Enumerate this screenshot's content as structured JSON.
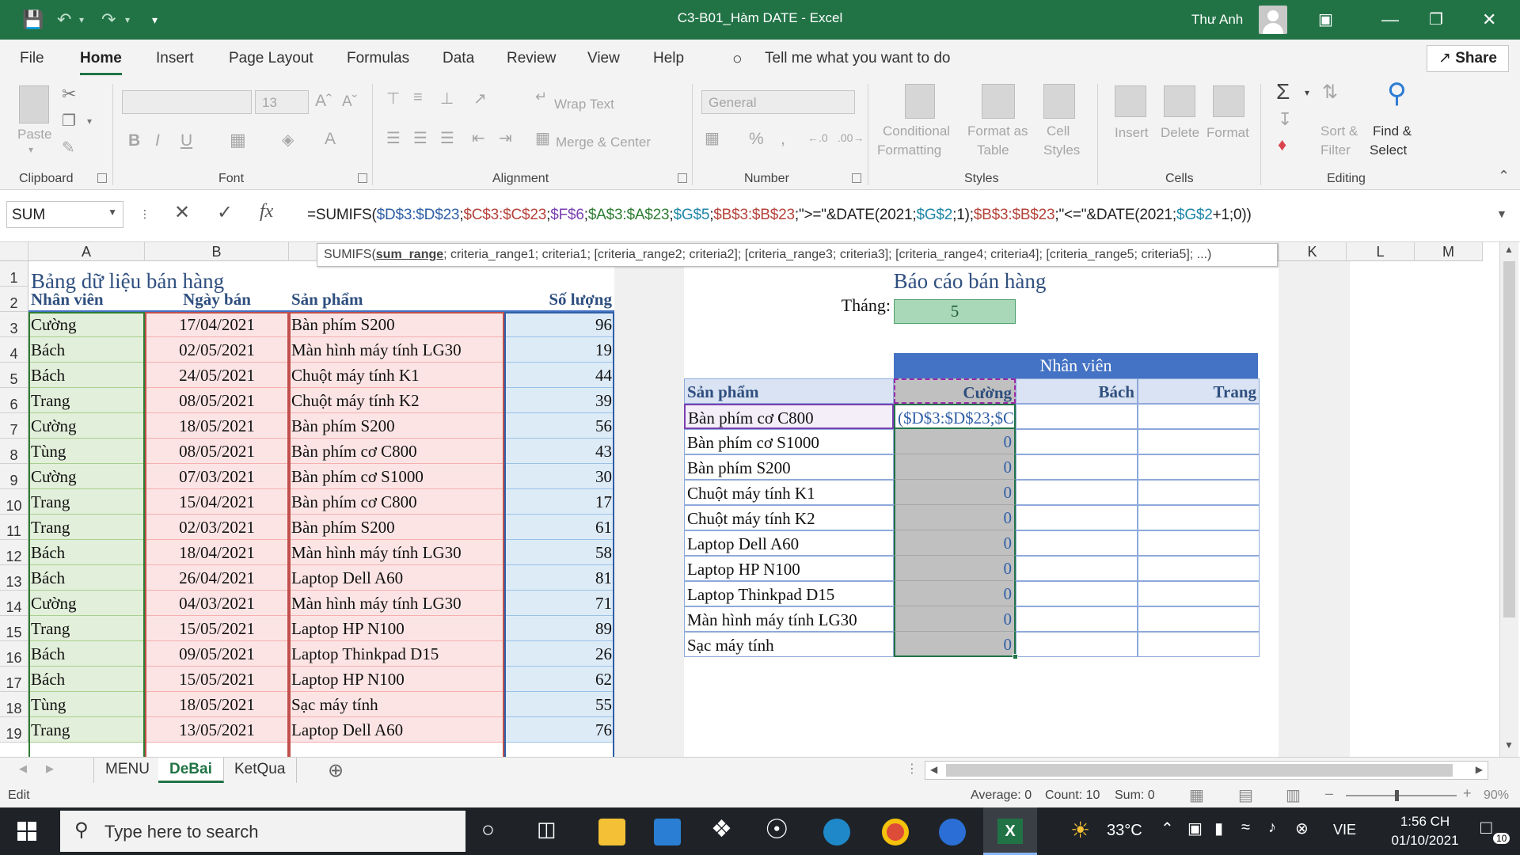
{
  "titlebar": {
    "doc_title": "C3-B01_Hàm DATE  -  Excel",
    "user": "Thư Anh"
  },
  "menu": {
    "tabs": [
      "File",
      "Home",
      "Insert",
      "Page Layout",
      "Formulas",
      "Data",
      "Review",
      "View",
      "Help"
    ],
    "tell_me": "Tell me what you want to do",
    "share": "Share"
  },
  "ribbon": {
    "clipboard": {
      "label": "Clipboard",
      "paste": "Paste"
    },
    "font": {
      "label": "Font",
      "size": "13"
    },
    "alignment": {
      "label": "Alignment",
      "wrap": "Wrap Text",
      "merge": "Merge & Center"
    },
    "number": {
      "label": "Number",
      "format": "General"
    },
    "styles": {
      "label": "Styles",
      "cond1": "Conditional",
      "cond2": "Formatting",
      "fmt1": "Format as",
      "fmt2": "Table",
      "cell1": "Cell",
      "cell2": "Styles"
    },
    "cells": {
      "label": "Cells",
      "insert": "Insert",
      "delete": "Delete",
      "format": "Format"
    },
    "editing": {
      "label": "Editing",
      "sort1": "Sort &",
      "sort2": "Filter",
      "find1": "Find &",
      "find2": "Select"
    }
  },
  "formula_bar": {
    "name_box": "SUM",
    "parts": [
      {
        "t": "=SUMIFS(",
        "c": ""
      },
      {
        "t": "$D$3:$D$23",
        "c": "r1"
      },
      {
        "t": ";",
        "c": ""
      },
      {
        "t": "$C$3:$C$23",
        "c": "r2"
      },
      {
        "t": ";",
        "c": ""
      },
      {
        "t": "$F$6",
        "c": "r3"
      },
      {
        "t": ";",
        "c": ""
      },
      {
        "t": "$A$3:$A$23",
        "c": "r4"
      },
      {
        "t": ";",
        "c": ""
      },
      {
        "t": "$G$5",
        "c": "r5"
      },
      {
        "t": ";",
        "c": ""
      },
      {
        "t": "$B$3:$B$23",
        "c": "r2"
      },
      {
        "t": ";\">=\"&DATE(2021;",
        "c": ""
      },
      {
        "t": "$G$2",
        "c": "r5"
      },
      {
        "t": ";1);",
        "c": ""
      },
      {
        "t": "$B$3:$B$23",
        "c": "r2"
      },
      {
        "t": ";\"<=\"&DATE(2021;",
        "c": ""
      },
      {
        "t": "$G$2",
        "c": "r5"
      },
      {
        "t": "+1;0))",
        "c": ""
      }
    ]
  },
  "tooltip": {
    "fn": "SUMIFS(",
    "bold_arg": "sum_range",
    "rest": "; criteria_range1; criteria1; [criteria_range2; criteria2]; [criteria_range3; criteria3]; [criteria_range4; criteria4]; [criteria_range5; criteria5]; ...)"
  },
  "columns": [
    "A",
    "B",
    "K",
    "L",
    "M"
  ],
  "rows": [
    "1",
    "2",
    "3",
    "4",
    "5",
    "6",
    "7",
    "8",
    "9",
    "10",
    "11",
    "12",
    "13",
    "14",
    "15",
    "16",
    "17",
    "18",
    "19"
  ],
  "left_table": {
    "title": "Bảng dữ liệu bán hàng",
    "headers": [
      "Nhân viên",
      "Ngày bán",
      "Sản phẩm",
      "Số lượng"
    ],
    "rows": [
      [
        "Cường",
        "17/04/2021",
        "Bàn phím S200",
        "96"
      ],
      [
        "Bách",
        "02/05/2021",
        "Màn hình máy tính LG30",
        "19"
      ],
      [
        "Bách",
        "24/05/2021",
        "Chuột máy tính K1",
        "44"
      ],
      [
        "Trang",
        "08/05/2021",
        "Chuột máy tính K2",
        "39"
      ],
      [
        "Cường",
        "18/05/2021",
        "Bàn phím S200",
        "56"
      ],
      [
        "Tùng",
        "08/05/2021",
        "Bàn phím cơ C800",
        "43"
      ],
      [
        "Cường",
        "07/03/2021",
        "Bàn phím cơ S1000",
        "30"
      ],
      [
        "Trang",
        "15/04/2021",
        "Bàn phím cơ C800",
        "17"
      ],
      [
        "Trang",
        "02/03/2021",
        "Bàn phím S200",
        "61"
      ],
      [
        "Bách",
        "18/04/2021",
        "Màn hình máy tính LG30",
        "58"
      ],
      [
        "Bách",
        "26/04/2021",
        "Laptop Dell A60",
        "81"
      ],
      [
        "Cường",
        "04/03/2021",
        "Màn hình máy tính LG30",
        "71"
      ],
      [
        "Trang",
        "15/05/2021",
        "Laptop HP N100",
        "89"
      ],
      [
        "Bách",
        "09/05/2021",
        "Laptop Thinkpad D15",
        "26"
      ],
      [
        "Bách",
        "15/05/2021",
        "Laptop HP N100",
        "62"
      ],
      [
        "Tùng",
        "18/05/2021",
        "Sạc máy tính",
        "55"
      ],
      [
        "Trang",
        "13/05/2021",
        "Laptop Dell A60",
        "76"
      ]
    ]
  },
  "report": {
    "title": "Báo cáo bán hàng",
    "month_label": "Tháng:",
    "month_value": "5",
    "staff_header": "Nhân viên",
    "product_header": "Sản phẩm",
    "staff": [
      "Cường",
      "Bách",
      "Trang"
    ],
    "editing_cell": "($D$3:$D$23;$C",
    "products": [
      "Bàn phím cơ C800",
      "Bàn phím cơ S1000",
      "Bàn phím S200",
      "Chuột máy tính K1",
      "Chuột máy tính K2",
      "Laptop Dell A60",
      "Laptop HP N100",
      "Laptop Thinkpad D15",
      "Màn hình máy tính LG30",
      "Sạc máy tính"
    ],
    "values": [
      "",
      "0",
      "0",
      "0",
      "0",
      "0",
      "0",
      "0",
      "0",
      "0"
    ]
  },
  "sheets": {
    "tabs": [
      "MENU",
      "DeBai",
      "KetQua"
    ],
    "active": "DeBai"
  },
  "status": {
    "mode": "Edit",
    "average": "Average: 0",
    "count": "Count: 10",
    "sum": "Sum: 0",
    "zoom": "90%"
  },
  "taskbar": {
    "search_placeholder": "Type here to search",
    "temp": "33°C",
    "lang": "VIE",
    "time": "1:56 CH",
    "date": "01/10/2021",
    "notif": "10"
  },
  "colors": {
    "excel_green": "#217346",
    "header_blue": "#4472c4",
    "col_a_fill": "#e2efda",
    "col_b_fill": "#fce4e4",
    "col_c_fill": "#fce4e4",
    "col_d_fill": "#ddebf7",
    "selected_fill": "#c0c0c0",
    "month_fill": "#a9d8b8"
  }
}
